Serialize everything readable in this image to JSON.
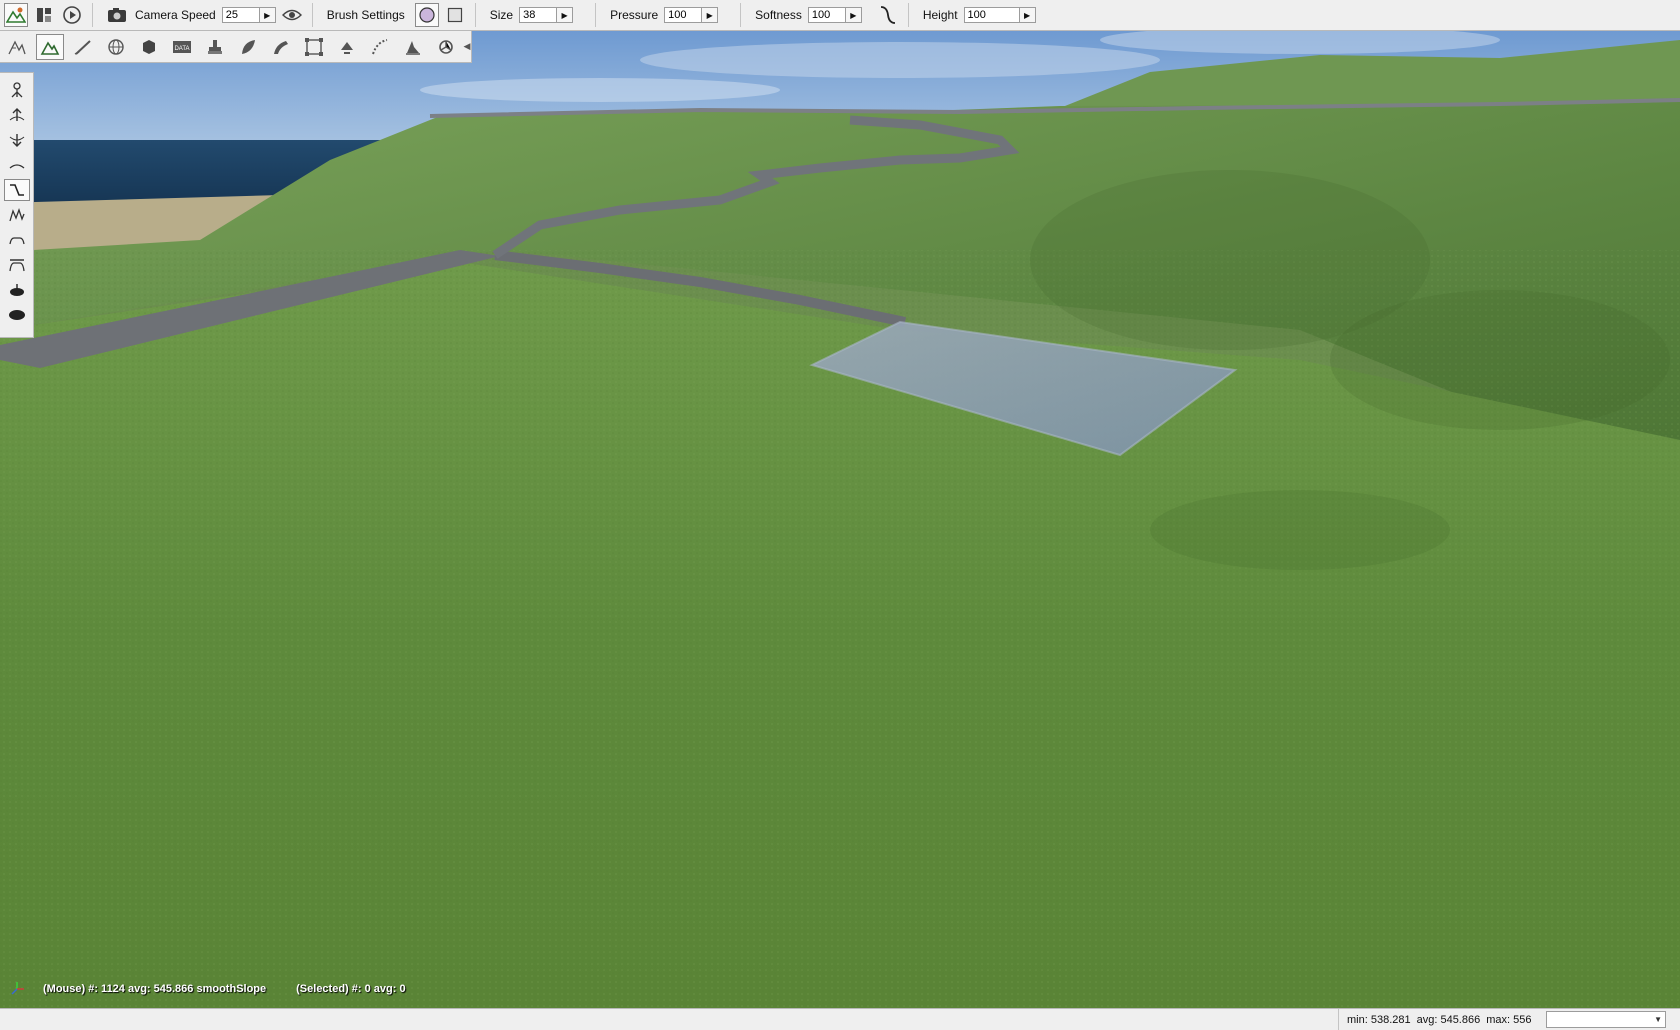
{
  "toolbar": {
    "camera_speed_label": "Camera Speed",
    "camera_speed_value": "25",
    "brush_settings_label": "Brush Settings",
    "size_label": "Size",
    "size_value": "38",
    "pressure_label": "Pressure",
    "pressure_value": "100",
    "softness_label": "Softness",
    "softness_value": "100",
    "height_label": "Height",
    "height_value": "100"
  },
  "icons": {
    "top": [
      "terrain-editor-icon",
      "layout-icon",
      "play-icon",
      "camera-icon",
      "visibility-eye-icon",
      "circle-brush-icon",
      "square-brush-icon",
      "softness-curve-icon"
    ],
    "tools": [
      "object-select-icon",
      "terrain-editor-icon",
      "terrain-painter-icon",
      "world-icon",
      "shape-icon",
      "datablock-icon",
      "decal-icon",
      "forest-icon",
      "river-icon",
      "mesh-road-icon",
      "road-icon",
      "navmesh-icon",
      "convex-icon",
      "particle-icon"
    ],
    "brushes": [
      "grab-terrain-icon",
      "raise-height-icon",
      "lower-height-icon",
      "smooth-height-icon",
      "smooth-slope-icon",
      "paint-noise-icon",
      "flatten-icon",
      "set-height-icon",
      "clear-terrain-icon",
      "restore-terrain-icon"
    ]
  },
  "overlay": {
    "mouse_info": "(Mouse) #: 1124  avg: 545.866 smoothSlope",
    "selected_info": "(Selected) #: 0  avg: 0"
  },
  "status": {
    "min": "min: 538.281",
    "avg": "avg: 545.866",
    "max": "max: 556",
    "select_value": ""
  },
  "colors": {
    "sky": "#6e9ad0",
    "sea": "#1f4568",
    "grass": "#62893f",
    "road": "#6e7176",
    "water": "#8a9ab0",
    "toolbar_bg": "#efefef"
  }
}
